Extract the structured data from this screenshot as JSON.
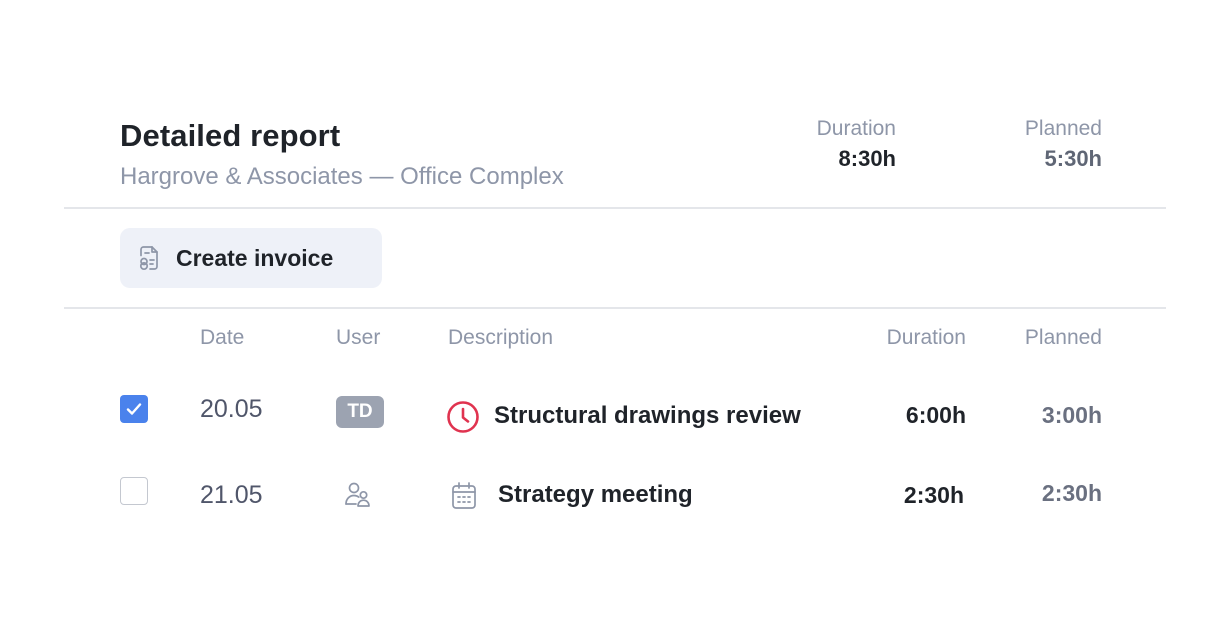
{
  "header": {
    "title": "Detailed report",
    "subtitle": "Hargrove & Associates — Office Complex",
    "summary": {
      "duration_label": "Duration",
      "duration_value": "8:30h",
      "planned_label": "Planned",
      "planned_value": "5:30h"
    }
  },
  "toolbar": {
    "create_invoice_label": "Create invoice",
    "create_invoice_icon": "invoice-icon"
  },
  "table": {
    "columns": {
      "date": "Date",
      "user": "User",
      "description": "Description",
      "duration": "Duration",
      "planned": "Planned"
    },
    "rows": [
      {
        "checked": true,
        "date": "20.05",
        "user": "TD",
        "description": "Structural drawings review",
        "description_icon": "clock-icon",
        "duration": "6:00h",
        "planned": "3:00h"
      },
      {
        "checked": false,
        "date": "21.05",
        "user_icon": "users-icon",
        "description": "Strategy meeting",
        "description_icon": "calendar-icon",
        "duration": "2:30h",
        "planned": "2:30h"
      }
    ]
  },
  "colors": {
    "accent": "#4a82ec",
    "clock_icon": "#e0334f",
    "muted_text": "#8e96a8",
    "avatar_bg": "#9ca3b1",
    "button_bg": "#eef1f8"
  }
}
